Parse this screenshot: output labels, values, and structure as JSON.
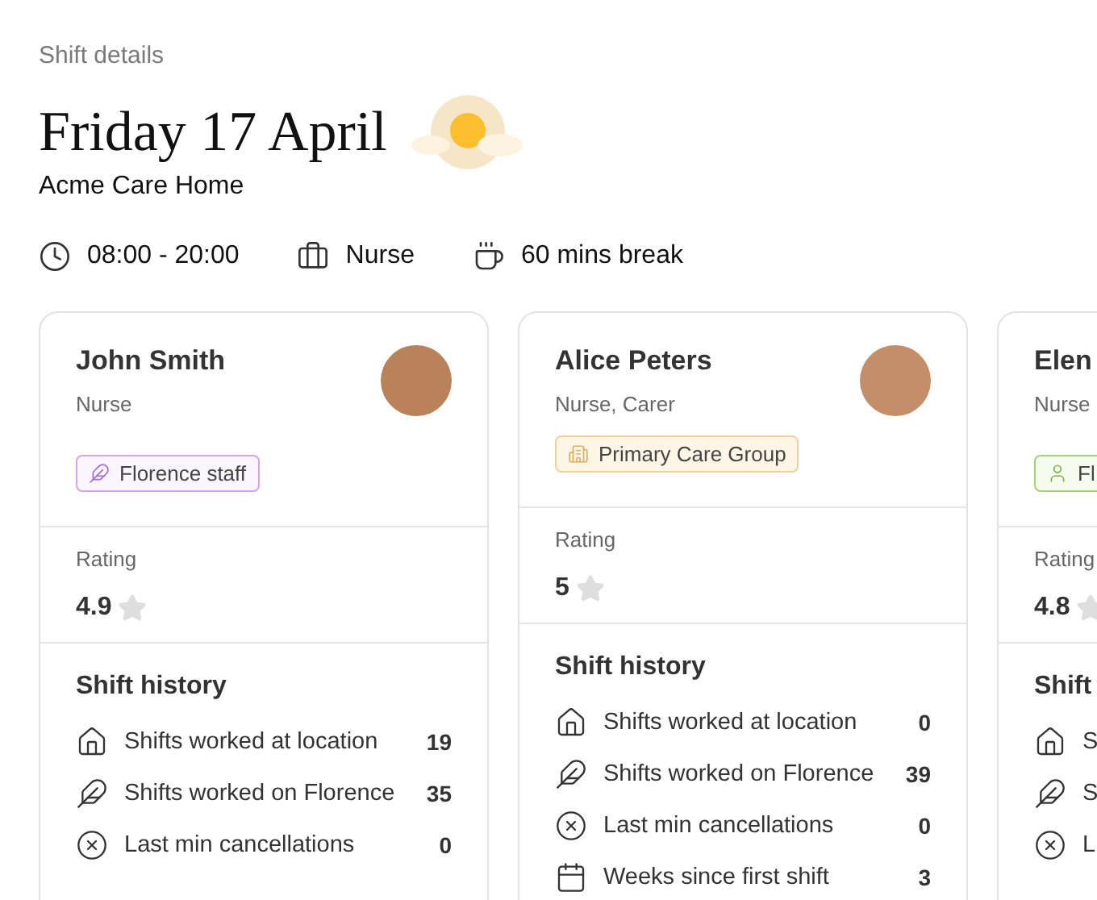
{
  "header": {
    "eyebrow": "Shift details",
    "title": "Friday 17 April",
    "location": "Acme Care Home"
  },
  "details": [
    {
      "kind": "time",
      "text": "08:00 - 20:00"
    },
    {
      "kind": "role",
      "text": "Nurse"
    },
    {
      "kind": "break",
      "text": "60 mins break"
    }
  ],
  "cards": [
    {
      "name": "John Smith",
      "role": "Nurse",
      "tag": {
        "kind": "staff",
        "label": "Florence staff"
      },
      "rating_label": "Rating",
      "rating": "4.9",
      "history_title": "Shift history",
      "history": [
        {
          "kind": "location",
          "label": "Shifts worked at location",
          "value": "19"
        },
        {
          "kind": "platform",
          "label": "Shifts worked on Florence",
          "value": "35"
        },
        {
          "kind": "cancel",
          "label": "Last min cancellations",
          "value": "0"
        }
      ]
    },
    {
      "name": "Alice Peters",
      "role": "Nurse, Carer",
      "tag": {
        "kind": "group",
        "label": "Primary Care Group"
      },
      "rating_label": "Rating",
      "rating": "5",
      "history_title": "Shift history",
      "history": [
        {
          "kind": "location",
          "label": "Shifts worked at location",
          "value": "0"
        },
        {
          "kind": "platform",
          "label": "Shifts worked on Florence",
          "value": "39"
        },
        {
          "kind": "cancel",
          "label": "Last min cancellations",
          "value": "0"
        },
        {
          "kind": "weeks",
          "label": "Weeks since first shift",
          "value": "3"
        }
      ]
    },
    {
      "name": "Elen",
      "role": "Nurse",
      "tag": {
        "kind": "user",
        "label": "Fl"
      },
      "rating_label": "Rating",
      "rating": "4.8",
      "history_title": "Shift",
      "history": [
        {
          "kind": "location",
          "label": "S"
        },
        {
          "kind": "platform",
          "label": "S"
        },
        {
          "kind": "cancel",
          "label": "L"
        }
      ]
    }
  ]
}
